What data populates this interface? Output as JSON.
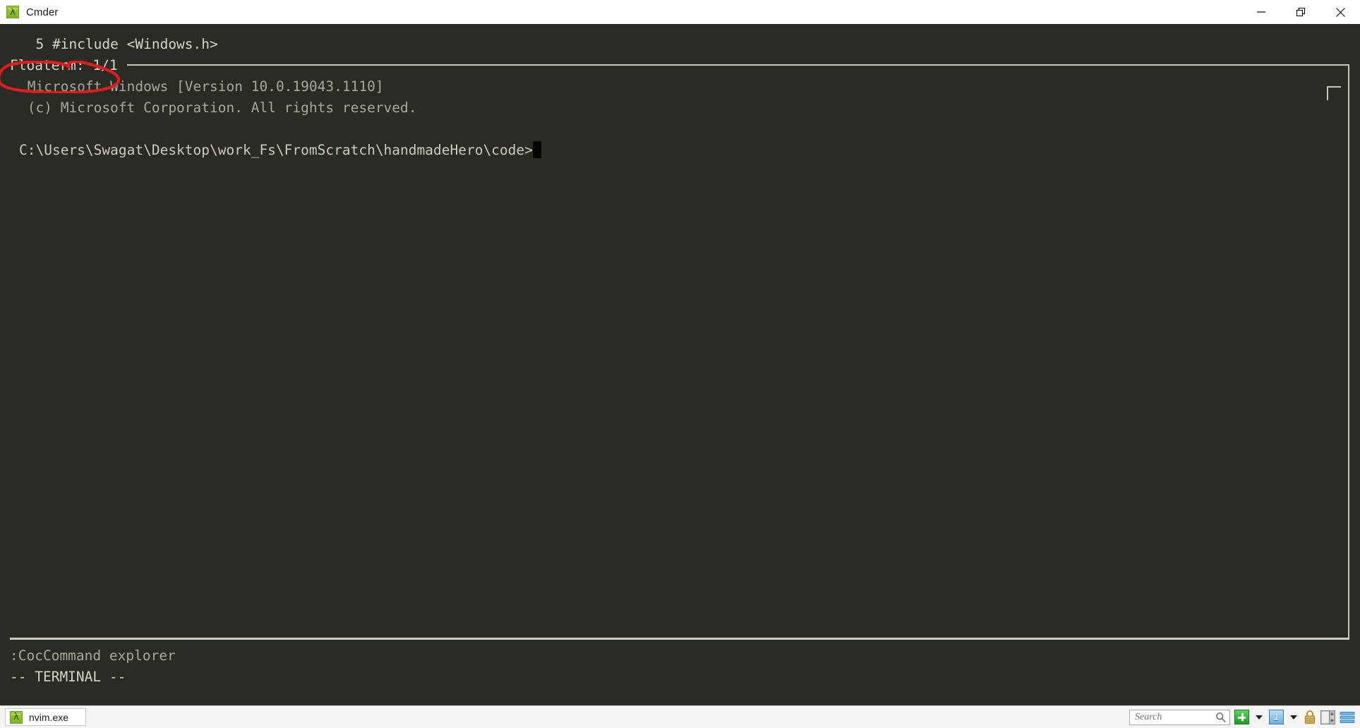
{
  "window": {
    "title": "Cmder",
    "app_icon": "lambda-icon",
    "controls": {
      "minimize": "minimize-icon",
      "restore": "restore-icon",
      "close": "close-icon"
    }
  },
  "terminal": {
    "background_color": "#292b25",
    "foreground_color": "#d7d3c8",
    "lines": {
      "editor_line": "  5 #include <Windows.h>",
      "floaterm_status": "Floaterm: 1/1",
      "windows_version": " Microsoft Windows [Version 10.0.19043.1110]",
      "copyright": " (c) Microsoft Corporation. All rights reserved.",
      "prompt": "C:\\Users\\Swagat\\Desktop\\work_Fs\\FromScratch\\handmadeHero\\code>",
      "command_line": ":CocCommand explorer",
      "mode_line": "-- TERMINAL --"
    },
    "cursor": "block-cursor"
  },
  "annotation": {
    "shape": "red-ellipse-highlight",
    "color": "#e01b1b",
    "targets": "Floaterm: 1/1"
  },
  "statusbar": {
    "tab": {
      "label": "nvim.exe",
      "icon": "lambda-icon"
    },
    "search": {
      "placeholder": "Search",
      "icon": "magnifier-icon"
    },
    "buttons": {
      "new_console": "plus-icon",
      "new_console_dropdown": "chevron-down-icon",
      "active_tab_number": "1",
      "tabs_dropdown": "chevron-down-icon",
      "lock": "lock-icon",
      "panels": "panel-layout-icon",
      "menu": "hamburger-menu-icon"
    }
  }
}
